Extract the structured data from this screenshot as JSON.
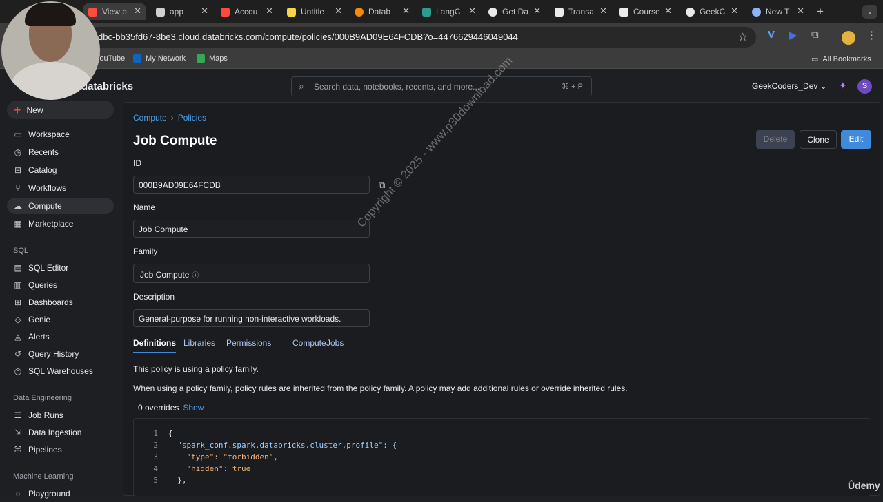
{
  "browser": {
    "tabs": [
      {
        "label": "View p",
        "color": "#ff4b3a",
        "active": true
      },
      {
        "label": "app",
        "color": "#d0d0d0"
      },
      {
        "label": "Accou",
        "color": "#ff4b3a"
      },
      {
        "label": "Untitle",
        "color": "#f7d549"
      },
      {
        "label": "Datab",
        "color": "#f58a07"
      },
      {
        "label": "LangC",
        "color": "#2a9d8f"
      },
      {
        "label": "Get Da",
        "color": "#e8eaed"
      },
      {
        "label": "Transa",
        "color": "#e8eaed"
      },
      {
        "label": "Course",
        "color": "#e8eaed"
      },
      {
        "label": "GeekC",
        "color": "#e8eaed"
      },
      {
        "label": "New T",
        "color": "#8ab4f8"
      }
    ],
    "url": "dbc-bb35fd67-8be3.cloud.databricks.com/compute/policies/000B9AD09E64FCDB?o=4476629446049044",
    "bookmarks": [
      "YouTube",
      "My Network",
      "Maps"
    ],
    "all_bookmarks": "All Bookmarks"
  },
  "app": {
    "brand": "databricks",
    "search_placeholder": "Search data, notebooks, recents, and more...",
    "search_shortcut": "⌘ + P",
    "workspace": "GeekCoders_Dev",
    "avatar_letter": "S"
  },
  "sidebar": {
    "new_label": "New",
    "items": [
      {
        "label": "Workspace",
        "icon": "folder-icon"
      },
      {
        "label": "Recents",
        "icon": "clock-icon"
      },
      {
        "label": "Catalog",
        "icon": "catalog-icon"
      },
      {
        "label": "Workflows",
        "icon": "workflows-icon"
      },
      {
        "label": "Compute",
        "icon": "cloud-icon",
        "active": true
      },
      {
        "label": "Marketplace",
        "icon": "store-icon"
      }
    ],
    "sql_section": "SQL",
    "sql_items": [
      "SQL Editor",
      "Queries",
      "Dashboards",
      "Genie",
      "Alerts",
      "Query History",
      "SQL Warehouses"
    ],
    "de_section": "Data Engineering",
    "de_items": [
      "Job Runs",
      "Data Ingestion",
      "Pipelines"
    ],
    "ml_section": "Machine Learning",
    "ml_items": [
      "Playground"
    ]
  },
  "page": {
    "breadcrumb": [
      "Compute",
      "Policies"
    ],
    "title": "Job Compute",
    "buttons": {
      "delete": "Delete",
      "clone": "Clone",
      "edit": "Edit"
    },
    "fields": {
      "id_label": "ID",
      "id_value": "000B9AD09E64FCDB",
      "name_label": "Name",
      "name_value": "Job Compute",
      "family_label": "Family",
      "family_value": "Job Compute",
      "description_label": "Description",
      "description_value": "General-purpose for running non-interactive workloads."
    },
    "tabs": [
      "Definitions",
      "Libraries",
      "Permissions",
      "Compute",
      "Jobs"
    ],
    "policy_family_text": "This policy is using a policy family.",
    "inherit_text": "When using a policy family, policy rules are inherited from the policy family. A policy may add additional rules or override inherited rules.",
    "overrides_count": "0 overrides",
    "overrides_show": "Show",
    "watermark": "Copyright © 2025 - www.p30download.com",
    "code": {
      "line_numbers": [
        "1",
        "2",
        "3",
        "4",
        "5"
      ],
      "lines": [
        "{",
        "  \"spark_conf.spark.databricks.cluster.profile\": {",
        "    \"type\": \"forbidden\",",
        "    \"hidden\": true",
        "  },"
      ]
    }
  },
  "udemy": "Ûdemy"
}
